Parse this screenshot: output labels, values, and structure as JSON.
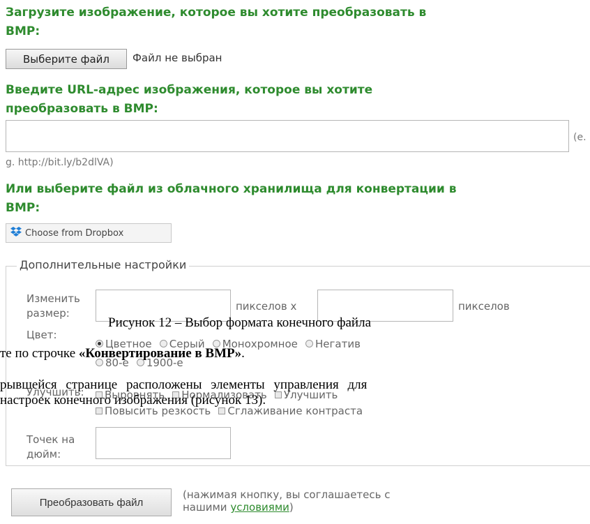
{
  "upload": {
    "title_line1": "Загрузите изображение, которое вы хотите преобразовать в",
    "title_line2": "BMP:",
    "choose_button": "Выберите файл",
    "no_file": "Файл не выбран"
  },
  "url": {
    "title_line1": "Введите URL-адрес изображения, которое вы хотите",
    "title_line2": "преобразовать в BMP:",
    "value": "",
    "hint_part1": "(e.",
    "hint_part2": "g. http://bit.ly/b2dlVA)"
  },
  "cloud": {
    "title_line1": "Или выберите файл из облачного хранилища для конвертации в",
    "title_line2": "BMP:",
    "dropbox_button": "Choose from Dropbox"
  },
  "settings": {
    "legend": "Дополнительные настройки",
    "resize_label_line1": "Изменить",
    "resize_label_line2": "размер:",
    "width_value": "",
    "height_value": "",
    "px_x": "пикселов x",
    "px": "пикселов",
    "color_label": "Цвет:",
    "color_options": [
      "Цветное",
      "Серый",
      "Монохромное",
      "Негатив",
      "80-е",
      "1900-е"
    ],
    "color_selected": "Цветное",
    "enhance_label": "Улучшить:",
    "enhance_options": [
      "Выровнять",
      "Нормализовать",
      "Улучшить",
      "Повысить резкость",
      "Сглаживание контраста"
    ],
    "dpi_label_line1": "Точек на",
    "dpi_label_line2": "дюйм:",
    "dpi_value": ""
  },
  "overlay": {
    "caption": "Рисунок 12 – Выбор формата конечного файла",
    "line1_prefix": "те по строчке ",
    "line1_bold": "«Конвертирование в BMP»",
    "line1_suffix": ".",
    "line2": "рывшейся странице расположены элементы управления для",
    "line3": "настроек конечного изображения (рисунок 13)."
  },
  "convert": {
    "button": "Преобразовать файл",
    "note_line1": "(нажимая кнопку, вы соглашаетесь с",
    "note_line2_prefix": "нашими ",
    "terms_link": "условиями",
    "note_line2_suffix": ")"
  },
  "colors": {
    "title_green": "#2e8b2e"
  }
}
